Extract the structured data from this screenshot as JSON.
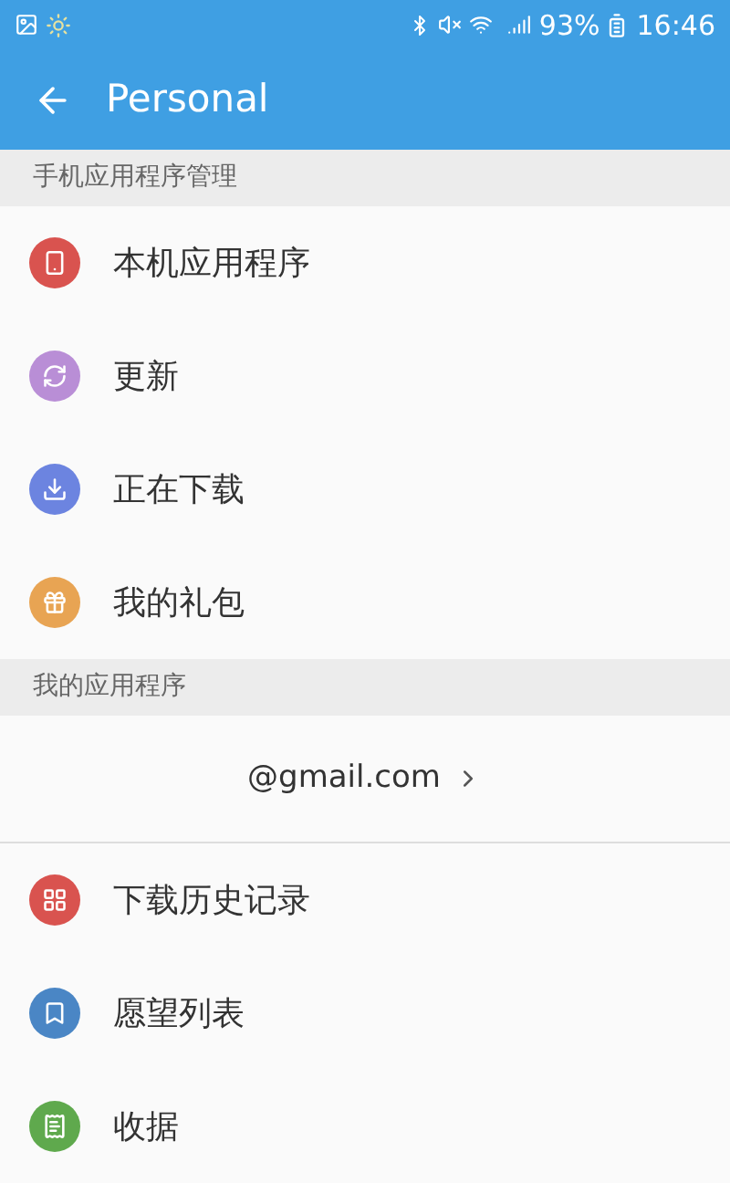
{
  "status_bar": {
    "battery": "93%",
    "time": "16:46"
  },
  "app_bar": {
    "title": "Personal"
  },
  "sections": [
    {
      "header": "手机应用程序管理",
      "items": [
        {
          "kind": "phone",
          "label": "本机应用程序",
          "color": "#d9534f"
        },
        {
          "kind": "refresh",
          "label": "更新",
          "color": "#b98ed6"
        },
        {
          "kind": "download",
          "label": "正在下载",
          "color": "#6c84e0"
        },
        {
          "kind": "gift",
          "label": "我的礼包",
          "color": "#e8a453"
        }
      ]
    },
    {
      "header": "我的应用程序",
      "account": "@gmail.com",
      "items": [
        {
          "kind": "grid",
          "label": "下载历史记录",
          "color": "#d9534f"
        },
        {
          "kind": "bookmark",
          "label": "愿望列表",
          "color": "#4a86c5"
        },
        {
          "kind": "receipt",
          "label": "收据",
          "color": "#5fa94d"
        }
      ]
    }
  ]
}
